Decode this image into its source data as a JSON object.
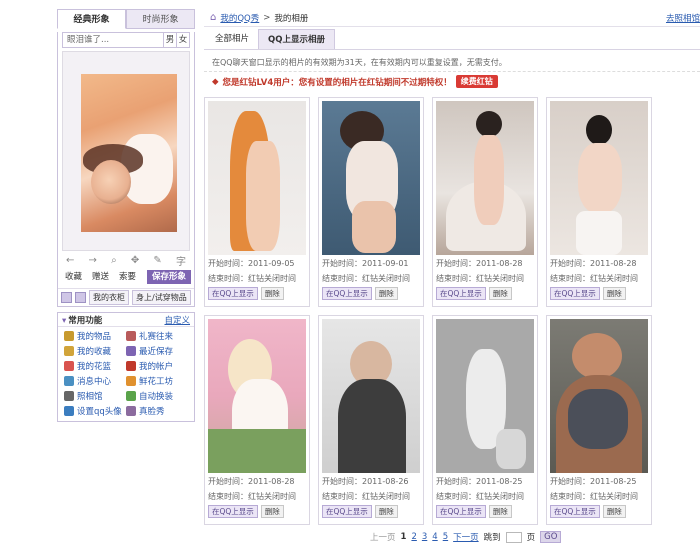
{
  "left": {
    "tabs": [
      "经典形象",
      "时尚形象"
    ],
    "search_text": "眼泪谁了...",
    "gender_toggle": [
      "男",
      "女"
    ],
    "tools": [
      "←",
      "→",
      "⌕",
      "✥",
      "✎",
      "字"
    ],
    "buttons": [
      "收藏",
      "赠送",
      "索要",
      "保存形象"
    ],
    "wardrobe": [
      "我的衣柜",
      "身上/试穿物品"
    ],
    "common": {
      "title": "常用功能",
      "customize": "自定义",
      "items": [
        {
          "label": "我的物品",
          "color": "#c79a2e"
        },
        {
          "label": "礼赛往来",
          "color": "#b95b5b"
        },
        {
          "label": "我的收藏",
          "color": "#d1a43a"
        },
        {
          "label": "最近保存",
          "color": "#7d64b2"
        },
        {
          "label": "我的花篮",
          "color": "#d9534f"
        },
        {
          "label": "我的帐户",
          "color": "#c0392b"
        },
        {
          "label": "消息中心",
          "color": "#4a90c2"
        },
        {
          "label": "鲜花工坊",
          "color": "#e0912f"
        },
        {
          "label": "照相馆",
          "color": "#666666"
        },
        {
          "label": "自动换装",
          "color": "#5aa34a"
        },
        {
          "label": "设置qq头像",
          "color": "#3b7dbf"
        },
        {
          "label": "真脸秀",
          "color": "#8b6b9e"
        }
      ]
    }
  },
  "breadcrumb": {
    "root": "我的QQ秀",
    "sep": ">",
    "current": "我的相册",
    "right": "去照相馆"
  },
  "tabs": [
    "全部相片",
    "QQ上显示相册"
  ],
  "notice": "在QQ聊天窗口显示的相片的有效期为31天，在有效期内可以重复设置，无需支付。",
  "vip": {
    "text": "您是红钻LV4用户：您有设置的相片在红钻期间不过期特权！",
    "button": "续费红钻"
  },
  "photo_labels": {
    "start": "开始时间：",
    "end_label": "结束时间：",
    "end_value": "红钻关闭时间",
    "show": "在QQ上显示",
    "del": "删除"
  },
  "photos": [
    {
      "start": "2011-09-05"
    },
    {
      "start": "2011-09-01"
    },
    {
      "start": "2011-08-28"
    },
    {
      "start": "2011-08-28"
    },
    {
      "start": "2011-08-28"
    },
    {
      "start": "2011-08-26"
    },
    {
      "start": "2011-08-25"
    },
    {
      "start": "2011-08-25"
    }
  ],
  "pager": {
    "prev": "上一页",
    "pages": [
      "1",
      "2",
      "3",
      "4",
      "5"
    ],
    "next": "下一页",
    "jump": "跳到",
    "page_unit": "页",
    "go": "GO"
  }
}
